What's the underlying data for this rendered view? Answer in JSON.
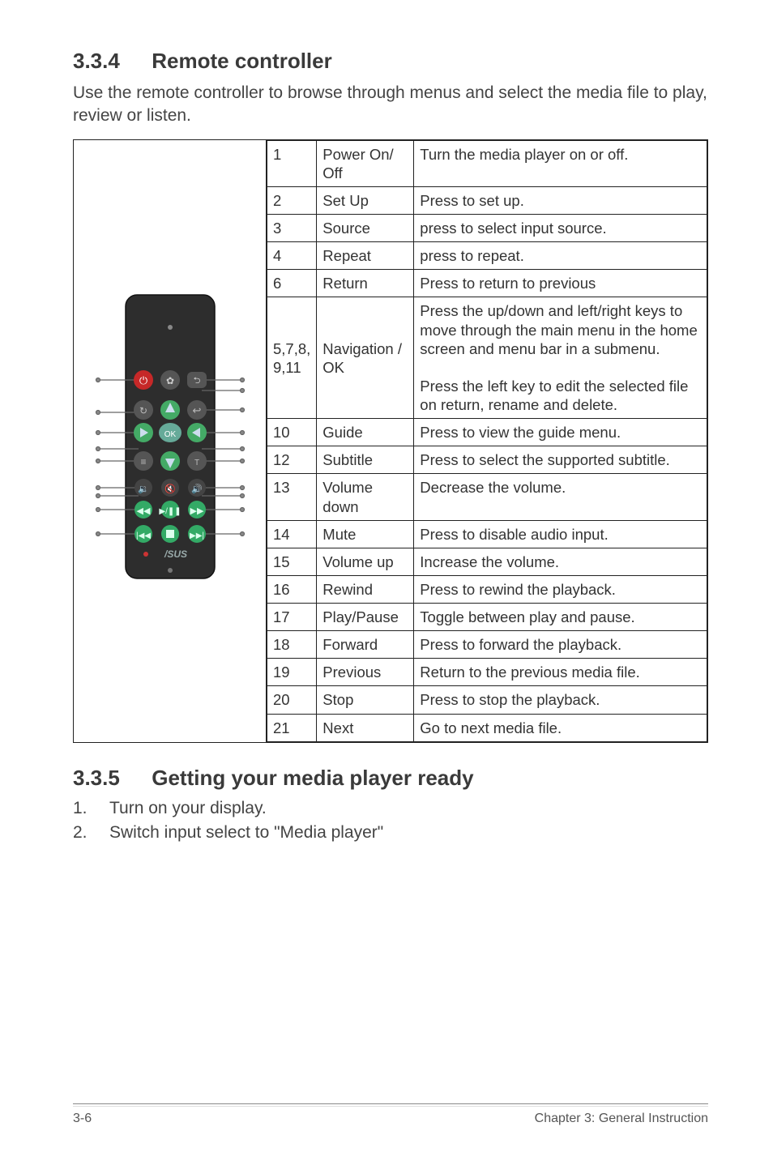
{
  "section1": {
    "num": "3.3.4",
    "title": "Remote controller",
    "intro": "Use the remote controller to browse through menus and select the media file to play, review or listen."
  },
  "table": {
    "rows": [
      {
        "n": "1",
        "name": "Power On/ Off",
        "desc": "Turn the media player on or off."
      },
      {
        "n": "2",
        "name": "Set Up",
        "desc": "Press to set up."
      },
      {
        "n": "3",
        "name": "Source",
        "desc": "press to select input source."
      },
      {
        "n": "4",
        "name": "Repeat",
        "desc": "press to repeat."
      },
      {
        "n": "6",
        "name": "Return",
        "desc": "Press to return to previous"
      },
      {
        "n": "5,7,8, 9,11",
        "name": "Navigation / OK",
        "desc": "Press the up/down and left/right keys to move through the main menu in the home screen and menu bar in a submenu.\n\nPress the left key to edit the selected file on return, rename and delete."
      },
      {
        "n": "10",
        "name": "Guide",
        "desc": "Press to view the guide menu."
      },
      {
        "n": "12",
        "name": "Subtitle",
        "desc": "Press to select the supported subtitle."
      },
      {
        "n": "13",
        "name": "Volume down",
        "desc": "Decrease the volume."
      },
      {
        "n": "14",
        "name": "Mute",
        "desc": "Press to disable audio input."
      },
      {
        "n": "15",
        "name": "Volume up",
        "desc": "Increase the volume."
      },
      {
        "n": "16",
        "name": "Rewind",
        "desc": "Press to rewind the playback."
      },
      {
        "n": "17",
        "name": "Play/Pause",
        "desc": "Toggle between play and pause."
      },
      {
        "n": "18",
        "name": "Forward",
        "desc": "Press to forward the playback."
      },
      {
        "n": "19",
        "name": "Previous",
        "desc": "Return to the previous media file."
      },
      {
        "n": "20",
        "name": "Stop",
        "desc": "Press to stop the playback."
      },
      {
        "n": "21",
        "name": "Next",
        "desc": "Go to next media file."
      }
    ]
  },
  "section2": {
    "num": "3.3.5",
    "title": "Getting your media player ready",
    "items": [
      {
        "n": "1.",
        "t": "Turn on your display."
      },
      {
        "n": "2.",
        "t": "Switch input select to \"Media player\""
      }
    ]
  },
  "footer": {
    "left": "3-6",
    "right": "Chapter 3: General Instruction"
  }
}
